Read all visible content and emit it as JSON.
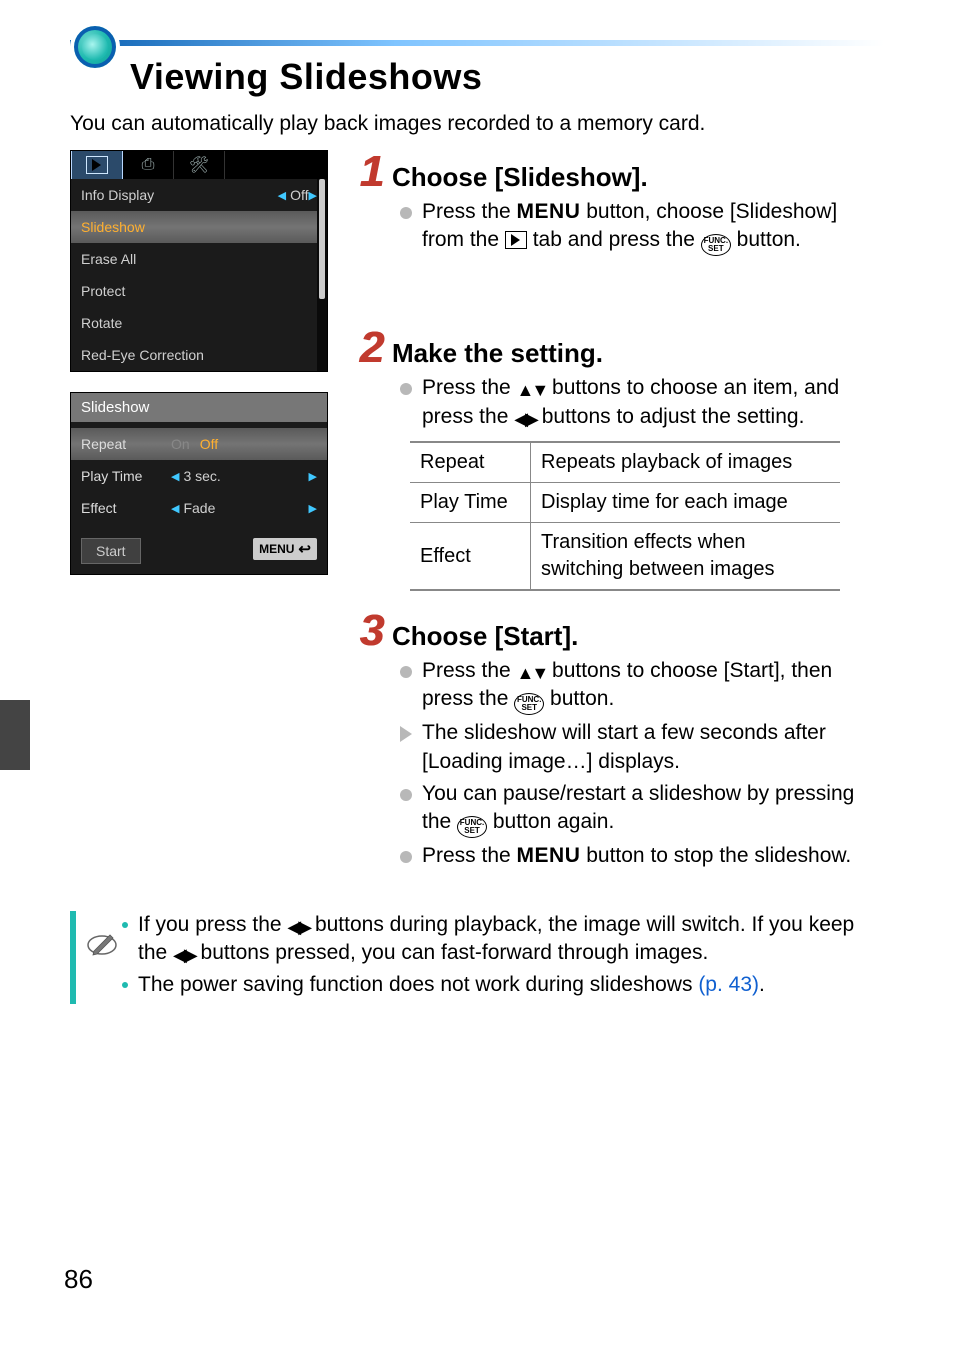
{
  "page_number": "86",
  "title": "Viewing Slideshows",
  "intro": "You can automatically play back images recorded to a memory card.",
  "menu1": {
    "tabs": {
      "play": "▶",
      "print": "⎙",
      "setup": "⚒"
    },
    "items": [
      {
        "label": "Info Display",
        "value": "Off",
        "arrow_left": true,
        "arrow_right": true
      },
      {
        "label": "Slideshow",
        "selected": true
      },
      {
        "label": "Erase All"
      },
      {
        "label": "Protect"
      },
      {
        "label": "Rotate"
      },
      {
        "label": "Red-Eye Correction"
      }
    ]
  },
  "menu2": {
    "title": "Slideshow",
    "rows": [
      {
        "label": "Repeat",
        "on": "On",
        "off": "Off",
        "selected": true
      },
      {
        "label": "Play Time",
        "value": "3 sec.",
        "arrow_left": true,
        "arrow_right": true
      },
      {
        "label": "Effect",
        "value": "Fade",
        "arrow_left": true,
        "arrow_right": true
      }
    ],
    "start": "Start",
    "menu": "MENU"
  },
  "steps": {
    "s1": {
      "num": "1",
      "title": "Choose [Slideshow].",
      "b1a": "Press the ",
      "b1b": " button, choose [Slideshow] from the ",
      "b1c": " tab and press the ",
      "b1d": " button.",
      "menu_label": "MENU",
      "func_label_top": "FUNC.",
      "func_label_bot": "SET"
    },
    "s2": {
      "num": "2",
      "title": "Make the setting.",
      "b1a": "Press the ",
      "b1b": " buttons to choose an item, and press the ",
      "b1c": " buttons to adjust the setting."
    },
    "table": [
      {
        "k": "Repeat",
        "v": "Repeats playback of images"
      },
      {
        "k": "Play Time",
        "v": "Display time for each image"
      },
      {
        "k": "Effect",
        "v": "Transition effects when switching between images"
      }
    ],
    "s3": {
      "num": "3",
      "title": "Choose [Start].",
      "b1a": "Press the ",
      "b1b": " buttons to choose [Start], then press the ",
      "b1c": " button.",
      "b2": "The slideshow will start a few seconds after [Loading image…] displays.",
      "b3a": "You can pause/restart a slideshow by pressing the ",
      "b3b": " button again.",
      "b4a": "Press the ",
      "b4b": " button to stop the slideshow.",
      "menu_label": "MENU"
    }
  },
  "note": {
    "n1a": "If you press the ",
    "n1b": " buttons during playback, the image will switch. If you keep the ",
    "n1c": " buttons pressed, you can fast-forward through images.",
    "n2a": "The power saving function does not work during slideshows ",
    "n2link": "(p. 43)",
    "n2b": "."
  }
}
